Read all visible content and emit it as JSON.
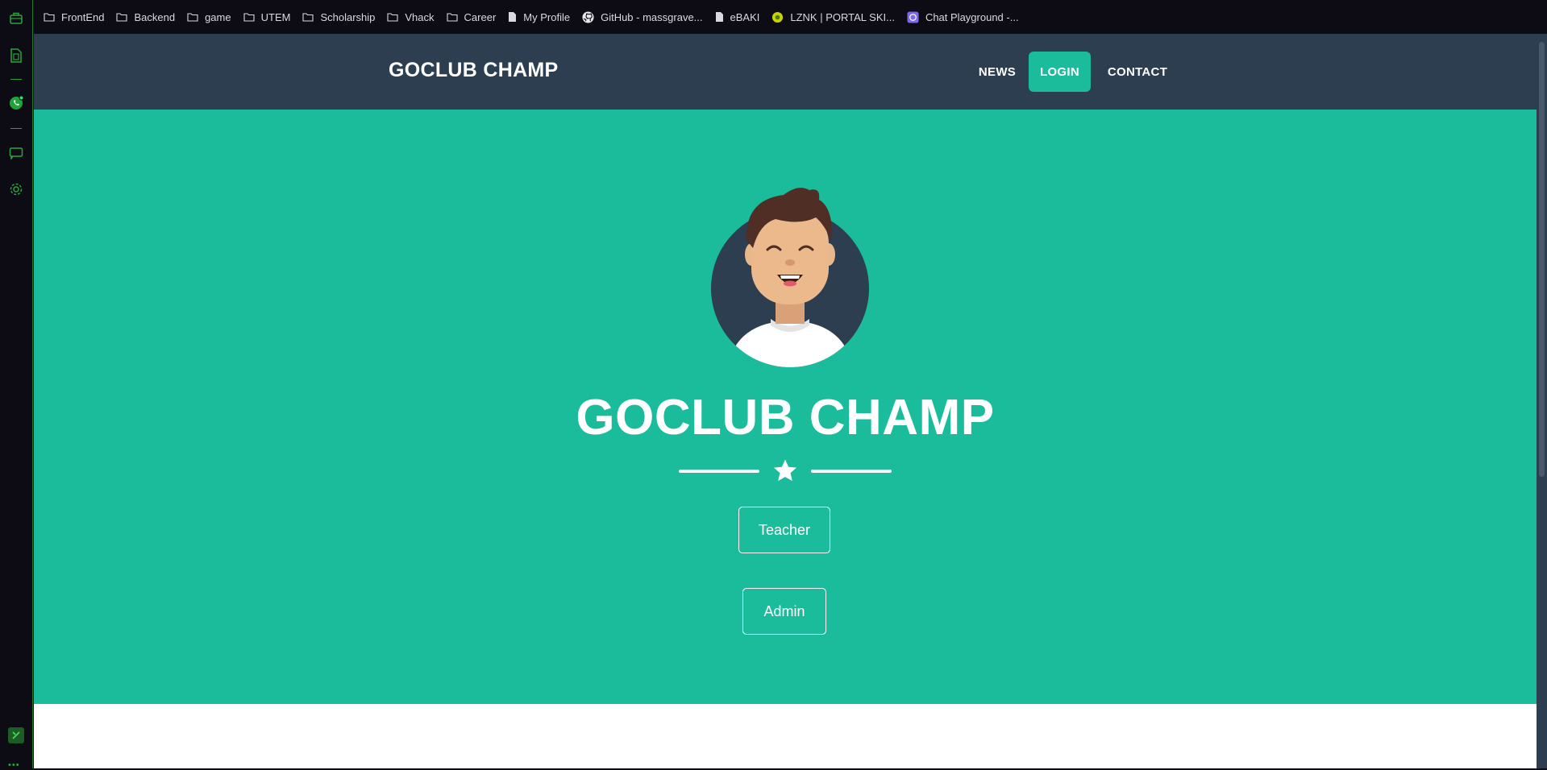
{
  "browser": {
    "bookmarks": [
      {
        "label": "FrontEnd",
        "icon": "folder-icon"
      },
      {
        "label": "Backend",
        "icon": "folder-icon"
      },
      {
        "label": "game",
        "icon": "folder-icon"
      },
      {
        "label": "UTEM",
        "icon": "folder-icon"
      },
      {
        "label": "Scholarship",
        "icon": "folder-icon"
      },
      {
        "label": "Vhack",
        "icon": "folder-icon"
      },
      {
        "label": "Career",
        "icon": "folder-icon"
      },
      {
        "label": "My Profile",
        "icon": "page-icon"
      },
      {
        "label": "GitHub - massgrave...",
        "icon": "github-icon"
      },
      {
        "label": "eBAKI",
        "icon": "page-icon"
      },
      {
        "label": "LZNK | PORTAL SKI...",
        "icon": "lznk-icon"
      },
      {
        "label": "Chat Playground -...",
        "icon": "chat-playground-icon"
      }
    ],
    "sidebar_icons": [
      "briefcase-icon",
      "sim-card-icon",
      "whatsapp-icon",
      "messages-icon",
      "gear-icon",
      "extension-icon"
    ],
    "accent": "#2aa33a"
  },
  "nav": {
    "brand": "GOCLUB CHAMP",
    "links": [
      "NEWS",
      "LOGIN",
      "CONTACT"
    ],
    "active": "LOGIN"
  },
  "hero": {
    "title": "GOCLUB CHAMP",
    "buttons": [
      "Teacher",
      "Admin"
    ]
  },
  "colors": {
    "primary": "#1abc9c",
    "navbar": "#2c3e50",
    "text": "#ffffff"
  }
}
